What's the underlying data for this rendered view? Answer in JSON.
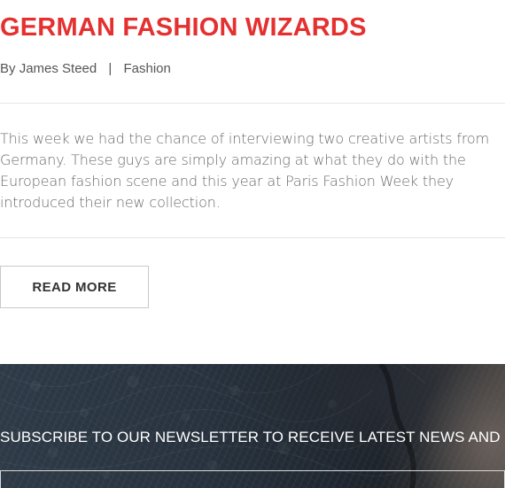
{
  "post": {
    "title": "GERMAN FASHION WIZARDS",
    "meta": {
      "by_prefix": "By",
      "author": "James Steed",
      "separator": "|",
      "category": "Fashion"
    },
    "excerpt": "This week we had the chance of interviewing two creative artists from Germany. These guys are simply amazing at what they do with the European fashion scene and this year at Paris Fashion Week they introduced their new collection.",
    "read_more_label": "READ MORE"
  },
  "newsletter": {
    "text": "SUBSCRIBE TO OUR NEWSLETTER TO RECEIVE LATEST NEWS AND OFFERS",
    "email_placeholder": ""
  },
  "colors": {
    "title": "#e53030",
    "meta_text": "#555555",
    "excerpt_text": "#6a6a6a",
    "divider": "#e6e6e6",
    "newsletter_bg": "#27323e"
  }
}
